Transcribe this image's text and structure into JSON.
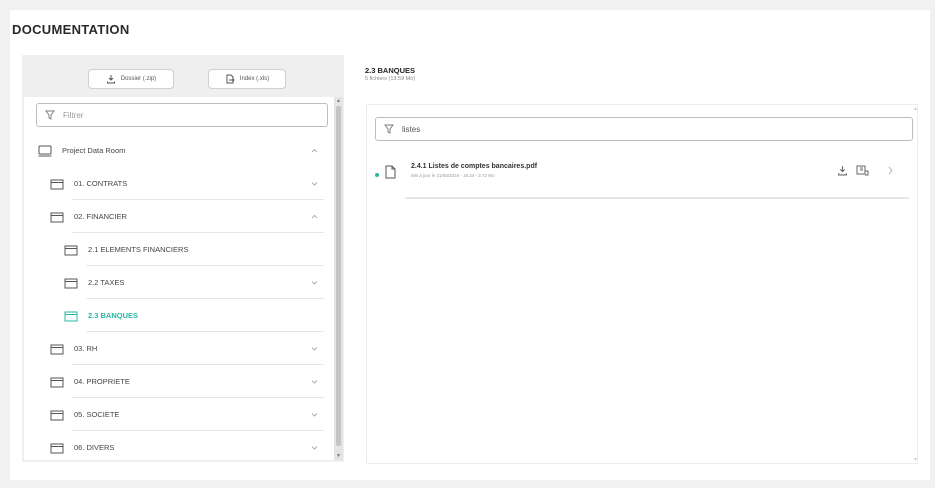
{
  "page": {
    "title": "DOCUMENTATION"
  },
  "toolbar": {
    "dossier_label": "Dossier (.zip)",
    "index_label": "Index (.xls)"
  },
  "tree": {
    "filter_placeholder": "Filtrer",
    "root": {
      "label": "Project Data Room",
      "expanded": true
    },
    "items": [
      {
        "label": "01. CONTRATS",
        "level": 1,
        "chevron": "down"
      },
      {
        "label": "02. FINANCIER",
        "level": 1,
        "chevron": "up"
      },
      {
        "label": "2.1 ELEMENTS FINANCIERS",
        "level": 2,
        "chevron": ""
      },
      {
        "label": "2.2 TAXES",
        "level": 2,
        "chevron": "down"
      },
      {
        "label": "2.3 BANQUES",
        "level": 2,
        "chevron": "",
        "active": true
      },
      {
        "label": "03. RH",
        "level": 1,
        "chevron": "down"
      },
      {
        "label": "04. PROPRIETE",
        "level": 1,
        "chevron": "down"
      },
      {
        "label": "05. SOCIETE",
        "level": 1,
        "chevron": "down"
      },
      {
        "label": "06. DIVERS",
        "level": 1,
        "chevron": "down"
      }
    ]
  },
  "section": {
    "title": "2.3 BANQUES",
    "subtitle": "5 fichiers (13.59 Mo)"
  },
  "file_filter": {
    "value": "listes"
  },
  "files": [
    {
      "name": "2.4.1 Listes de comptes bancaires.pdf",
      "meta": "Mis à jour le 31/08/2018 - 16:34 - 2.72 Mo"
    }
  ],
  "colors": {
    "accent": "#27b8a4",
    "background": "#f1f1f1",
    "panel": "#efefef"
  }
}
